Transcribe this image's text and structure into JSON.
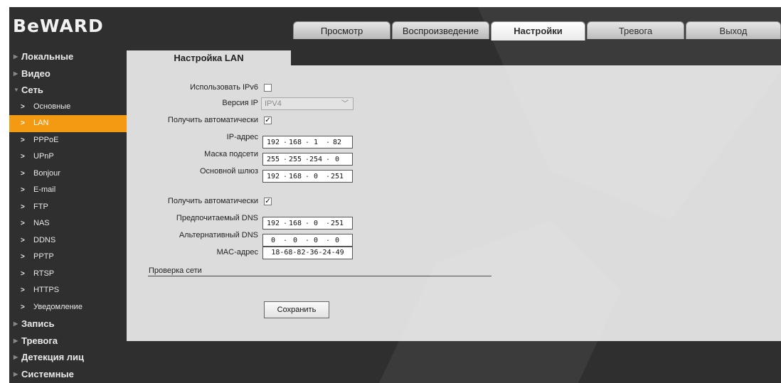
{
  "brand": {
    "logo": "BeWARD"
  },
  "top_tabs": [
    {
      "label": "Просмотр",
      "active": false
    },
    {
      "label": "Воспроизведение",
      "active": false
    },
    {
      "label": "Настройки",
      "active": true
    },
    {
      "label": "Тревога",
      "active": false
    },
    {
      "label": "Выход",
      "active": false
    }
  ],
  "sidebar": {
    "sections": [
      {
        "label": "Локальные"
      },
      {
        "label": "Видео"
      },
      {
        "label": "Сеть",
        "expanded": true
      }
    ],
    "network_items": [
      "Основные",
      "LAN",
      "PPPoE",
      "UPnP",
      "Bonjour",
      "E-mail",
      "FTP",
      "NAS",
      "DDNS",
      "PPTP",
      "RTSP",
      "HTTPS",
      "Уведомление"
    ],
    "active_item": "LAN",
    "lower_sections": [
      {
        "label": "Запись"
      },
      {
        "label": "Тревога"
      },
      {
        "label": "Детекция лиц"
      },
      {
        "label": "Системные"
      }
    ]
  },
  "panel": {
    "title": "Настройка LAN",
    "use_ipv6_label": "Использовать IPv6",
    "use_ipv6": false,
    "ip_version_label": "Версия IP",
    "ip_version_value": "IPV4",
    "auto_ip_label": "Получить автоматически",
    "auto_ip": true,
    "ip_address_label": "IP-адрес",
    "ip_address": [
      "192",
      "168",
      "1",
      "82"
    ],
    "subnet_label": "Маска подсети",
    "subnet": [
      "255",
      "255",
      "254",
      "0"
    ],
    "gateway_label": "Основной шлюз",
    "gateway": [
      "192",
      "168",
      "0",
      "251"
    ],
    "auto_dns_label": "Получить автоматически",
    "auto_dns": true,
    "pref_dns_label": "Предпочитаемый DNS",
    "pref_dns": [
      "192",
      "168",
      "0",
      "251"
    ],
    "alt_dns_label": "Альтернативный DNS",
    "alt_dns": [
      "0",
      "0",
      "0",
      "0"
    ],
    "mac_label": "MAC-адрес",
    "mac": "18-68-82-36-24-49",
    "network_check_label": "Проверка сети",
    "save_label": "Сохранить"
  },
  "colors": {
    "accent": "#f39a12",
    "background": "#2f2f2f",
    "panel": "#dcdcdc"
  }
}
